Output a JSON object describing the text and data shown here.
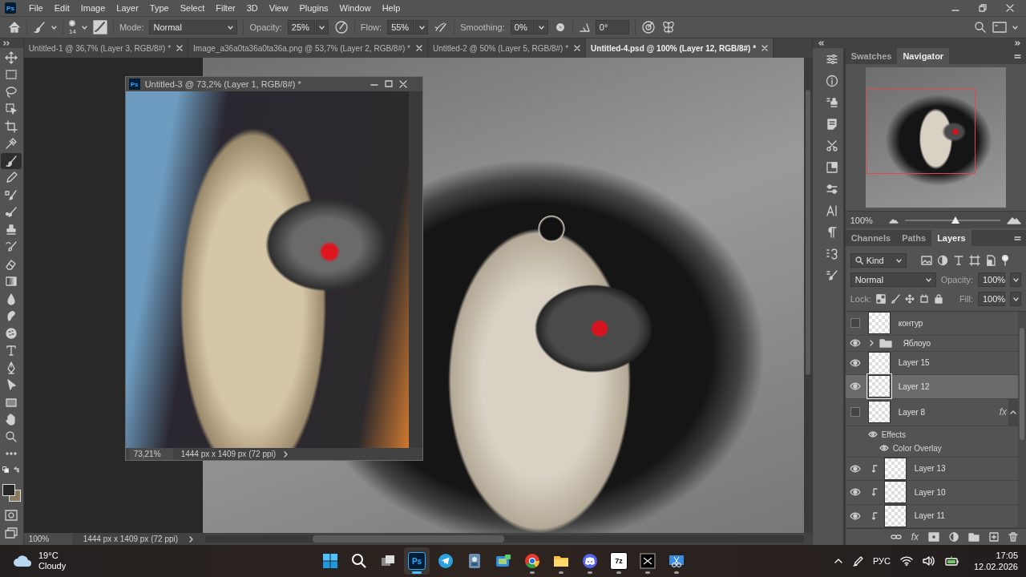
{
  "app": {
    "logo": "Ps"
  },
  "menu_bar": [
    "File",
    "Edit",
    "Image",
    "Layer",
    "Type",
    "Select",
    "Filter",
    "3D",
    "View",
    "Plugins",
    "Window",
    "Help"
  ],
  "options_bar": {
    "brush_size": "14",
    "mode_label": "Mode:",
    "mode": "Normal",
    "opacity_label": "Opacity:",
    "opacity": "25%",
    "flow_label": "Flow:",
    "flow": "55%",
    "smoothing_label": "Smoothing:",
    "smoothing": "0%",
    "angle": "0°"
  },
  "document_tabs": [
    {
      "label": "Untitled-1 @ 36,7% (Layer 3, RGB/8#) *",
      "selected": false
    },
    {
      "label": "Image_a36a0ta36a0ta36a.png @ 53,7% (Layer 2, RGB/8#) *",
      "selected": false
    },
    {
      "label": "Untitled-2 @ 50% (Layer 5, RGB/8#) *",
      "selected": false
    },
    {
      "label": "Untitled-4.psd @ 100% (Layer 12, RGB/8#) *",
      "selected": true
    }
  ],
  "tools": [
    {
      "kind": "move",
      "selected": false
    },
    {
      "kind": "marquee",
      "selected": false
    },
    {
      "kind": "lasso",
      "selected": false
    },
    {
      "kind": "object-select",
      "selected": false
    },
    {
      "kind": "crop",
      "selected": false
    },
    {
      "kind": "eyedropper",
      "selected": false
    },
    {
      "kind": "brush",
      "selected": true
    },
    {
      "kind": "pencil",
      "selected": false
    },
    {
      "kind": "mixer-brush",
      "selected": false
    },
    {
      "kind": "healing-brush",
      "selected": false
    },
    {
      "kind": "stamp",
      "selected": false
    },
    {
      "kind": "history-brush",
      "selected": false
    },
    {
      "kind": "eraser",
      "selected": false
    },
    {
      "kind": "gradient",
      "selected": false
    },
    {
      "kind": "blur",
      "selected": false
    },
    {
      "kind": "smudge",
      "selected": false
    },
    {
      "kind": "sponge",
      "selected": false
    },
    {
      "kind": "type",
      "selected": false
    },
    {
      "kind": "pen",
      "selected": false
    },
    {
      "kind": "path-select",
      "selected": false
    },
    {
      "kind": "rectangle",
      "selected": false
    },
    {
      "kind": "hand",
      "selected": false
    },
    {
      "kind": "zoom",
      "selected": false
    },
    {
      "kind": "more",
      "selected": false
    }
  ],
  "floating_window": {
    "logo": "Ps",
    "title": "Untitled-3 @ 73,2% (Layer 1, RGB/8#) *",
    "zoom": "73,21%",
    "doc_info": "1444 px x 1409 px (72 ppi)"
  },
  "status_bar": {
    "zoom": "100%",
    "doc_info": "1444 px x 1409 px (72 ppi)"
  },
  "navigator_panel": {
    "tabs": [
      {
        "label": "Swatches",
        "selected": false
      },
      {
        "label": "Navigator",
        "selected": true
      }
    ],
    "zoom": "100%",
    "level": 0.53
  },
  "layers_panel": {
    "tabs": [
      {
        "label": "Channels",
        "selected": false
      },
      {
        "label": "Paths",
        "selected": false
      },
      {
        "label": "Layers",
        "selected": true
      }
    ],
    "filter": "Kind",
    "blend_mode": "Normal",
    "opacity_label": "Opacity:",
    "opacity": "100%",
    "lock_label": "Lock:",
    "fill_label": "Fill:",
    "fill": "100%",
    "layers": [
      {
        "name": "контур",
        "kind": "layer",
        "visible": false,
        "selected": false
      },
      {
        "name": "Яблоуо",
        "kind": "group",
        "visible": true,
        "selected": false,
        "expanded": false
      },
      {
        "name": "Layer 15",
        "kind": "layer",
        "visible": true,
        "selected": false
      },
      {
        "name": "Layer 12",
        "kind": "layer",
        "visible": true,
        "selected": true
      },
      {
        "name": "Layer 8",
        "kind": "layer",
        "visible": false,
        "selected": false,
        "fx": "fx",
        "expanded": true,
        "children": [
          {
            "name": "Effects",
            "children": [
              {
                "name": "Color Overlay"
              }
            ]
          }
        ]
      },
      {
        "name": "Layer 13",
        "kind": "clipped",
        "visible": true,
        "selected": false
      },
      {
        "name": "Layer 10",
        "kind": "clipped",
        "visible": true,
        "selected": false
      },
      {
        "name": "Layer 11",
        "kind": "clipped",
        "visible": true,
        "selected": false
      }
    ],
    "footer_fx": "fx"
  },
  "taskbar": {
    "weather": {
      "temperature": "19°C",
      "condition": "Cloudy"
    },
    "apps": [
      {
        "kind": "start",
        "running": false,
        "active": false
      },
      {
        "kind": "search",
        "running": false,
        "active": false
      },
      {
        "kind": "task-view",
        "running": false,
        "active": false
      },
      {
        "kind": "photoshop",
        "label": "Ps",
        "running": true,
        "active": true
      },
      {
        "kind": "telegram",
        "running": false,
        "active": false
      },
      {
        "kind": "photos",
        "running": false,
        "active": false
      },
      {
        "kind": "gallery",
        "running": false,
        "active": false
      },
      {
        "kind": "chrome",
        "running": true,
        "active": false
      },
      {
        "kind": "explorer",
        "running": true,
        "active": false
      },
      {
        "kind": "discord",
        "running": true,
        "active": false
      },
      {
        "kind": "archiver",
        "label": "7z",
        "running": true,
        "active": false
      },
      {
        "kind": "tablet",
        "running": true,
        "active": false
      },
      {
        "kind": "snipping",
        "running": true,
        "active": false
      }
    ],
    "language": "РУС",
    "time": "17:05",
    "date": "12.02.2026"
  }
}
